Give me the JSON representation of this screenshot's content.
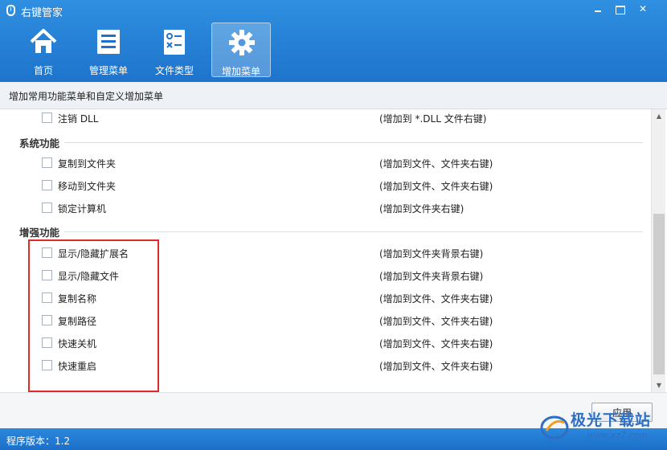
{
  "window": {
    "title": "右键管家",
    "controls": [
      "minimize",
      "maximize",
      "close"
    ]
  },
  "toolbar": {
    "items": [
      {
        "label": "首页",
        "icon": "home-icon",
        "active": false
      },
      {
        "label": "管理菜单",
        "icon": "list-icon",
        "active": false
      },
      {
        "label": "文件类型",
        "icon": "file-type-icon",
        "active": false
      },
      {
        "label": "增加菜单",
        "icon": "gear-icon",
        "active": true
      }
    ]
  },
  "subtitle": "增加常用功能菜单和自定义增加菜单",
  "list": {
    "top_item": {
      "name": "注销 DLL",
      "desc": "(增加到 *.DLL 文件右键)",
      "checked": false
    },
    "sections": [
      {
        "title": "系统功能",
        "items": [
          {
            "name": "复制到文件夹",
            "desc": "(增加到文件、文件夹右键)",
            "checked": false
          },
          {
            "name": "移动到文件夹",
            "desc": "(增加到文件、文件夹右键)",
            "checked": false
          },
          {
            "name": "锁定计算机",
            "desc": "(增加到文件夹右键)",
            "checked": false
          }
        ]
      },
      {
        "title": "增强功能",
        "items": [
          {
            "name": "显示/隐藏扩展名",
            "desc": "(增加到文件夹背景右键)",
            "checked": false
          },
          {
            "name": "显示/隐藏文件",
            "desc": "(增加到文件夹背景右键)",
            "checked": false
          },
          {
            "name": "复制名称",
            "desc": "(增加到文件、文件夹右键)",
            "checked": false
          },
          {
            "name": "复制路径",
            "desc": "(增加到文件、文件夹右键)",
            "checked": false
          },
          {
            "name": "快速关机",
            "desc": "(增加到文件、文件夹右键)",
            "checked": false
          },
          {
            "name": "快速重启",
            "desc": "(增加到文件、文件夹右键)",
            "checked": false
          }
        ]
      }
    ]
  },
  "footer": {
    "apply_label": "应用",
    "version_text": "程序版本：1.2"
  },
  "watermark": {
    "text": "极光下载站",
    "url": "www.xz7.com"
  },
  "colors": {
    "header_blue": "#1e74cc",
    "highlight_red": "#e02a2a"
  }
}
